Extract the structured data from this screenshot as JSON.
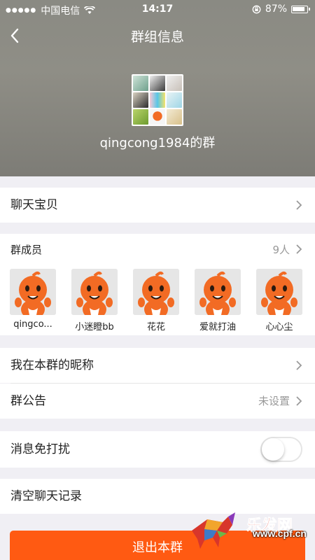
{
  "status_bar": {
    "carrier": "中国电信",
    "time": "14:17",
    "battery": "87%"
  },
  "nav": {
    "back_icon": "chevron-left-icon",
    "title": "群组信息"
  },
  "group": {
    "name": "qingcong1984的群"
  },
  "rows": {
    "chat_treasure": "聊天宝贝",
    "nickname": "我在本群的昵称",
    "announcement": "群公告",
    "announcement_value": "未设置",
    "mute": "消息免打扰",
    "clear_history": "清空聊天记录"
  },
  "members": {
    "title": "群成员",
    "count": "9人",
    "list": [
      {
        "name": "qingco..."
      },
      {
        "name": "小迷瞪bb"
      },
      {
        "name": "花花"
      },
      {
        "name": "爱就打油"
      },
      {
        "name": "心心尘"
      }
    ]
  },
  "mute_toggle": {
    "on": false
  },
  "exit_button": "退出本群",
  "watermark": {
    "brand": "乐发网",
    "url": "www.cpf.cn"
  },
  "colors": {
    "accent": "#ff5a12",
    "header_bg": "#8a8a83",
    "page_bg": "#f0eff4",
    "avatar_orange": "#f26b24"
  }
}
